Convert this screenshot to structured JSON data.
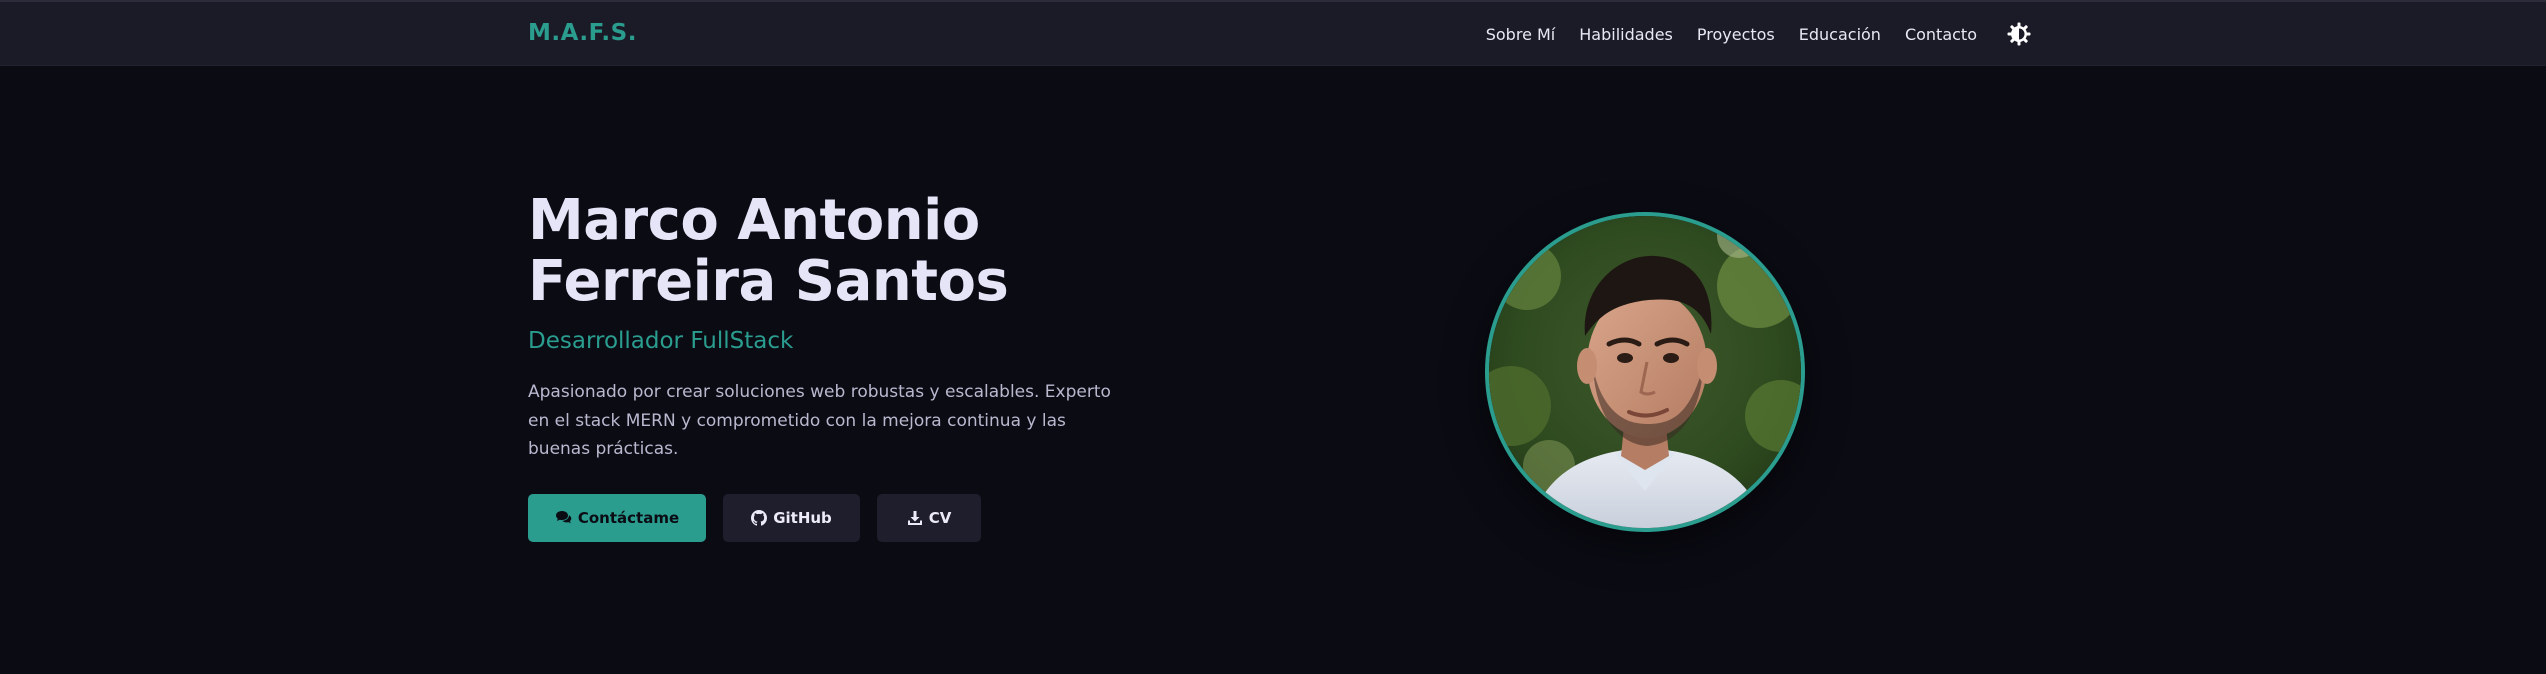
{
  "header": {
    "brand": "M.A.F.S.",
    "nav": [
      {
        "label": "Sobre Mí"
      },
      {
        "label": "Habilidades"
      },
      {
        "label": "Proyectos"
      },
      {
        "label": "Educación"
      },
      {
        "label": "Contacto"
      }
    ],
    "theme_toggle_icon": "theme-toggle-icon"
  },
  "hero": {
    "name_line1": "Marco Antonio",
    "name_line2": "Ferreira Santos",
    "role": "Desarrollador FullStack",
    "description": "Apasionado por crear soluciones web robustas y escalables. Experto en el stack MERN y comprometido con la mejora continua y las buenas prácticas.",
    "buttons": {
      "contact": {
        "label": "Contáctame",
        "icon": "chat-icon"
      },
      "github": {
        "label": "GitHub",
        "icon": "github-icon"
      },
      "cv": {
        "label": "CV",
        "icon": "download-icon"
      }
    }
  },
  "colors": {
    "accent": "#2a9d8f",
    "background": "#0b0b14",
    "navbar": "#1b1b28",
    "heading": "#e6e4f7",
    "body_text": "#b9b8cf",
    "button_dark": "#1e1e2c"
  }
}
